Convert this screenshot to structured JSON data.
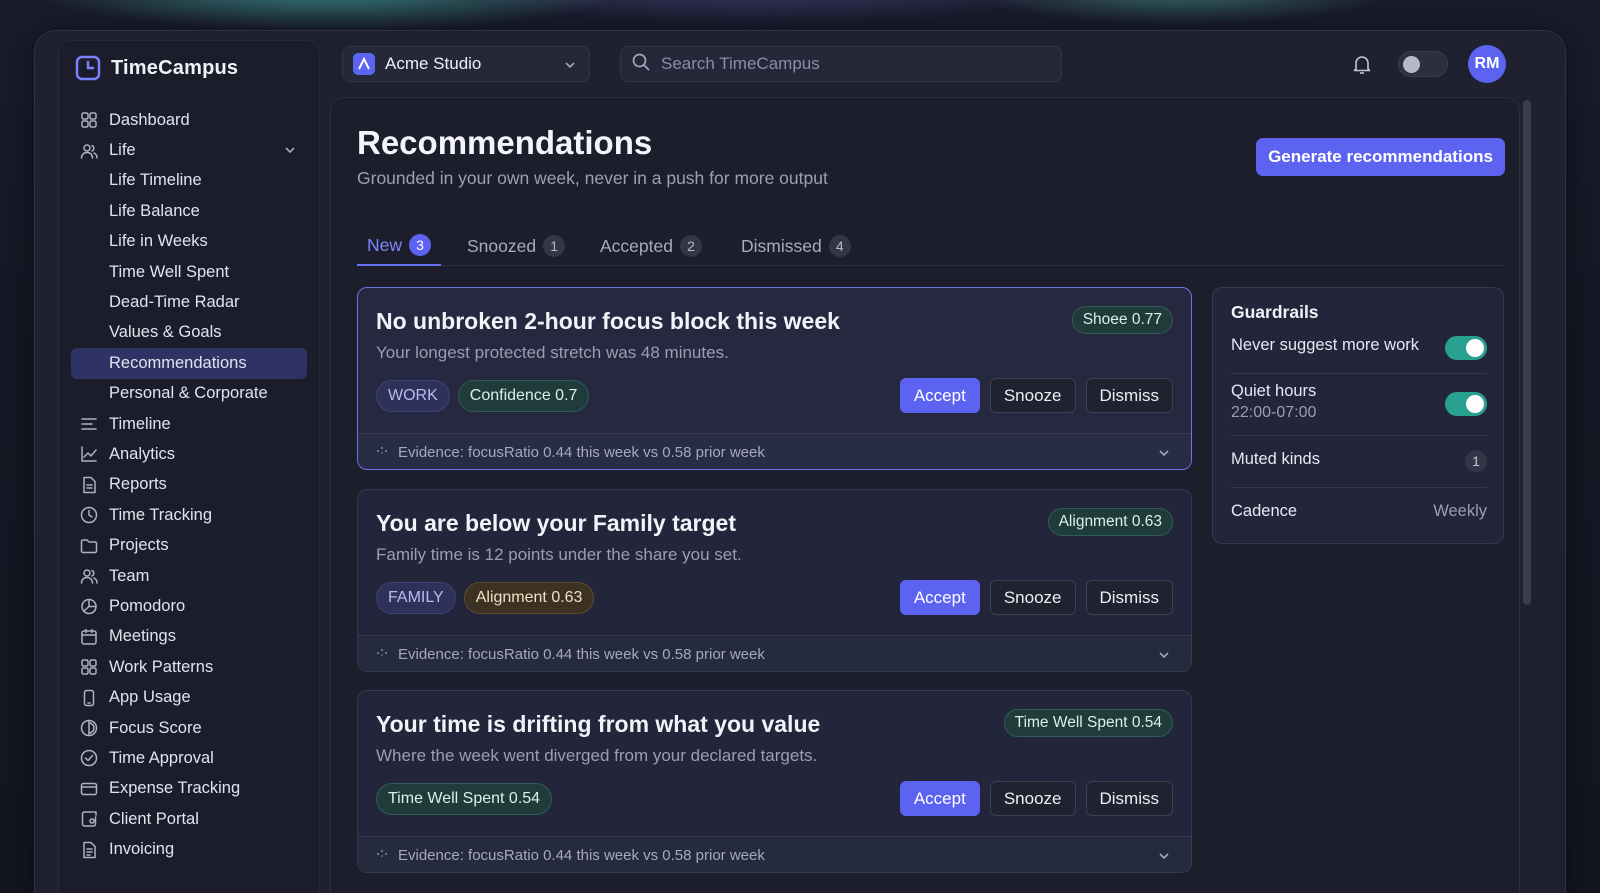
{
  "app": {
    "name": "TimeCampus"
  },
  "workspace": {
    "name": "Acme Studio",
    "initial": "A"
  },
  "search": {
    "placeholder": "Search TimeCampus"
  },
  "user": {
    "initials": "RM"
  },
  "sidebar": {
    "items": [
      {
        "label": "Dashboard",
        "icon": "grid-icon",
        "sub": false
      },
      {
        "label": "Life",
        "icon": "people-icon",
        "sub": false,
        "expanded": true
      },
      {
        "label": "Life Timeline",
        "sub": true
      },
      {
        "label": "Life Balance",
        "sub": true
      },
      {
        "label": "Life in Weeks",
        "sub": true
      },
      {
        "label": "Time Well Spent",
        "sub": true
      },
      {
        "label": "Dead-Time Radar",
        "sub": true
      },
      {
        "label": "Values & Goals",
        "sub": true
      },
      {
        "label": "Recommendations",
        "sub": true,
        "active": true
      },
      {
        "label": "Personal & Corporate",
        "sub": true
      },
      {
        "label": "Timeline",
        "icon": "lines-icon",
        "sub": false
      },
      {
        "label": "Analytics",
        "icon": "chart-icon",
        "sub": false
      },
      {
        "label": "Reports",
        "icon": "document-icon",
        "sub": false
      },
      {
        "label": "Time Tracking",
        "icon": "clock-icon",
        "sub": false
      },
      {
        "label": "Projects",
        "icon": "folder-icon",
        "sub": false
      },
      {
        "label": "Team",
        "icon": "people-icon",
        "sub": false
      },
      {
        "label": "Pomodoro",
        "icon": "pomodoro-icon",
        "sub": false
      },
      {
        "label": "Meetings",
        "icon": "calendar-icon",
        "sub": false
      },
      {
        "label": "Work Patterns",
        "icon": "grid-icon",
        "sub": false
      },
      {
        "label": "App Usage",
        "icon": "phone-icon",
        "sub": false
      },
      {
        "label": "Focus Score",
        "icon": "focus-icon",
        "sub": false
      },
      {
        "label": "Time Approval",
        "icon": "check-circle-icon",
        "sub": false
      },
      {
        "label": "Expense Tracking",
        "icon": "card-icon",
        "sub": false
      },
      {
        "label": "Client Portal",
        "icon": "portal-icon",
        "sub": false
      },
      {
        "label": "Invoicing",
        "icon": "invoice-icon",
        "sub": false
      }
    ]
  },
  "page": {
    "title": "Recommendations",
    "subtitle": "Grounded in your own week, never in a push for more output",
    "generate_label": "Generate recommendations"
  },
  "tabs": [
    {
      "label": "New",
      "count": "3",
      "active": true
    },
    {
      "label": "Snoozed",
      "count": "1"
    },
    {
      "label": "Accepted",
      "count": "2"
    },
    {
      "label": "Dismissed",
      "count": "4"
    }
  ],
  "cards": [
    {
      "title": "No unbroken 2-hour focus block this week",
      "description": "Your longest protected stretch was 48 minutes.",
      "score": "Shoee 0.77",
      "tags": [
        {
          "label": "WORK",
          "style": "kind"
        },
        {
          "label": "Confidence 0.7",
          "style": "green"
        }
      ],
      "evidence": "Evidence: focusRatio 0.44 this week vs 0.58 prior week",
      "highlight": true
    },
    {
      "title": "You are below your Family target",
      "description": "Family time is 12 points under the share you set.",
      "score": "Alignment 0.63",
      "tags": [
        {
          "label": "FAMILY",
          "style": "kind"
        },
        {
          "label": "Alignment 0.63",
          "style": "amber"
        }
      ],
      "evidence": "Evidence: focusRatio 0.44 this week vs 0.58 prior week",
      "highlight": false
    },
    {
      "title": "Your time is drifting from what you value",
      "description": "Where the week went diverged from your declared targets.",
      "score": "Time Well Spent 0.54",
      "tags": [
        {
          "label": "Time Well Spent 0.54",
          "style": "green"
        }
      ],
      "evidence": "Evidence: focusRatio 0.44 this week vs 0.58 prior week",
      "highlight": false
    }
  ],
  "card_actions": {
    "accept": "Accept",
    "snooze": "Snooze",
    "dismiss": "Dismiss"
  },
  "guardrails": {
    "title": "Guardrails",
    "never_more_work": {
      "label": "Never suggest more work",
      "on": true
    },
    "quiet_hours": {
      "label": "Quiet hours",
      "value": "22:00-07:00",
      "on": true
    },
    "muted_kinds": {
      "label": "Muted kinds",
      "count": "1"
    },
    "cadence": {
      "label": "Cadence",
      "value": "Weekly"
    }
  },
  "colors": {
    "accent": "#5b63f0",
    "teal": "#2aa18f",
    "background": "#1c1e2c"
  }
}
